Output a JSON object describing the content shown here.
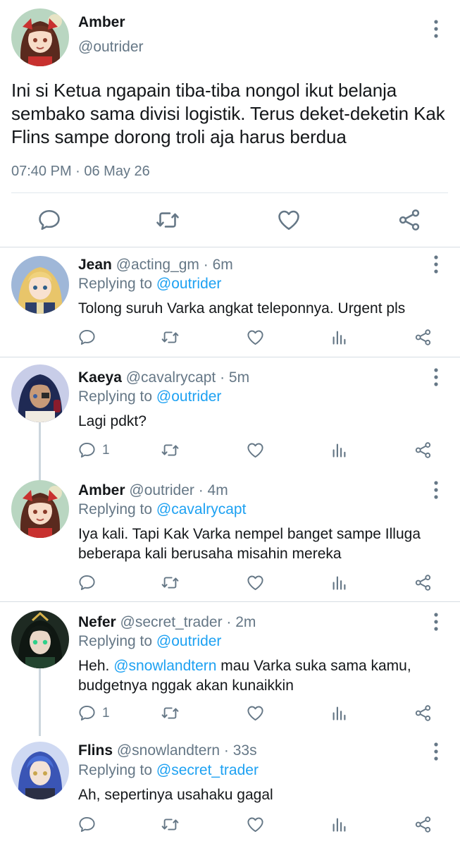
{
  "main_tweet": {
    "name": "Amber",
    "handle": "@outrider",
    "text": "Ini si Ketua ngapain tiba-tiba nongol ikut belanja sembako sama divisi logistik. Terus deket-deketin Kak Flins sampe dorong troli aja harus berdua",
    "timestamp": "07:40 PM · 06 May 26",
    "icons": [
      "comment-icon",
      "retweet-icon",
      "like-icon",
      "share-icon"
    ]
  },
  "replies": [
    {
      "name": "Jean",
      "meta": "@acting_gm · 6m",
      "replying_prefix": "Replying to",
      "replying_to": "@outrider",
      "text": "Tolong suruh Varka angkat teleponnya. Urgent pls",
      "reply_count": ""
    },
    {
      "name": "Kaeya",
      "meta": "@cavalrycapt · 5m",
      "replying_prefix": "Replying to",
      "replying_to": "@outrider",
      "text": "Lagi pdkt?",
      "reply_count": "1"
    },
    {
      "name": "Amber",
      "meta": "@outrider · 4m",
      "replying_prefix": "Replying to",
      "replying_to": "@cavalrycapt",
      "text": "Iya kali. Tapi Kak Varka nempel banget sampe Illuga beberapa kali berusaha misahin mereka",
      "reply_count": ""
    },
    {
      "name": "Nefer",
      "meta": "@secret_trader · 2m",
      "replying_prefix": "Replying to",
      "replying_to": "@outrider",
      "text_before": "Heh. ",
      "mention": "@snowlandtern",
      "text_after": " mau Varka suka sama kamu, budgetnya nggak akan kunaikkin",
      "reply_count": "1"
    },
    {
      "name": "Flins",
      "meta": "@snowlandtern · 33s",
      "replying_prefix": "Replying to",
      "replying_to": "@secret_trader",
      "text": "Ah, sepertinya usahaku gagal",
      "reply_count": ""
    }
  ],
  "colors": {
    "link": "#1da1f2",
    "secondary_text": "#657786",
    "icon": "#657786",
    "divider": "#e1e8ed",
    "thread_line": "#ccd6dd"
  }
}
